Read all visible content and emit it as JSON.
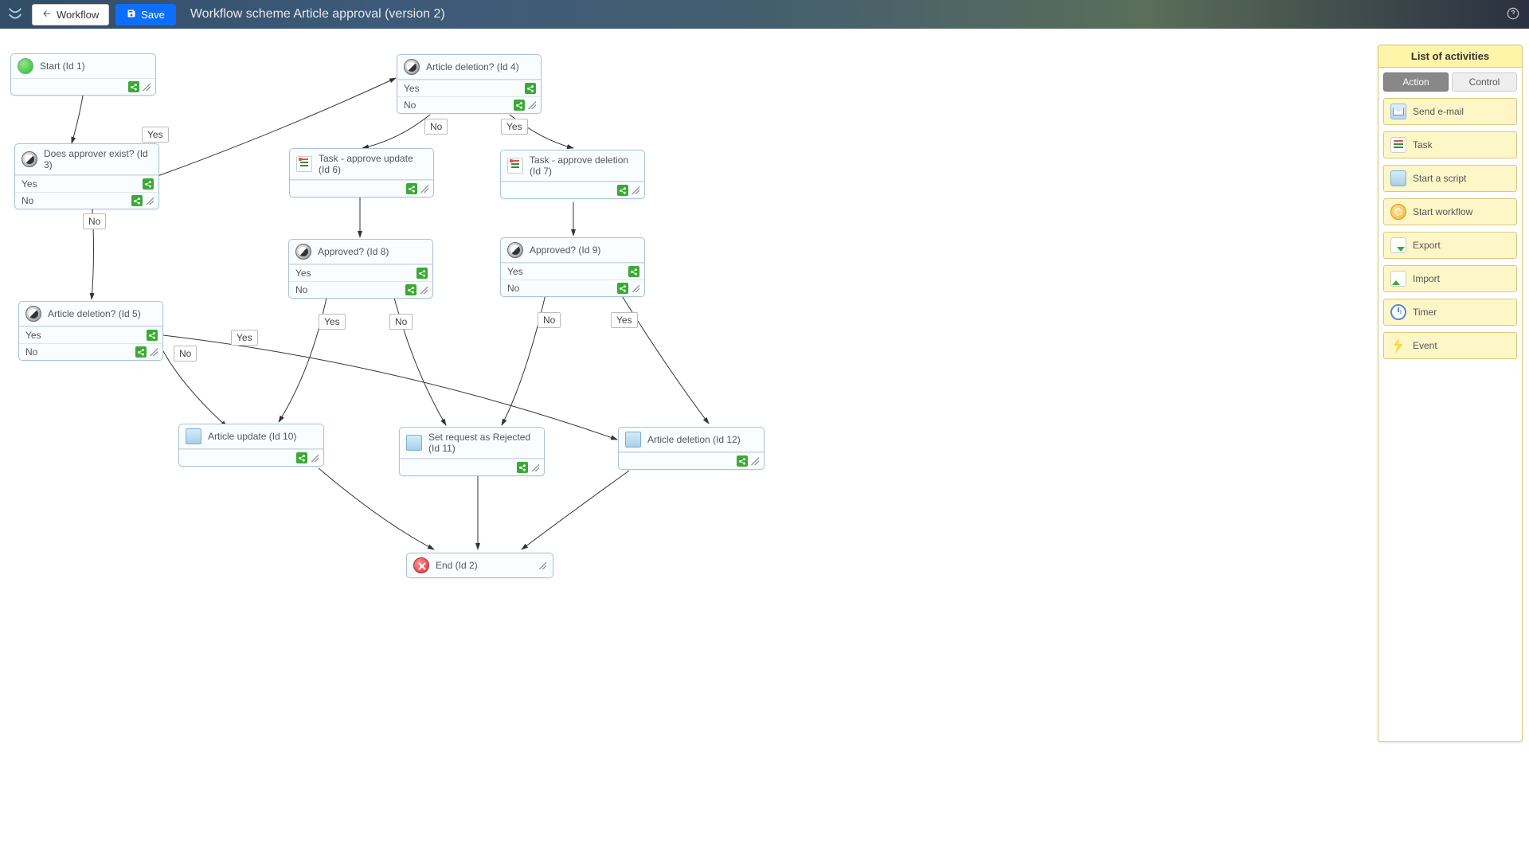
{
  "header": {
    "workflow_button": "Workflow",
    "save_button": "Save",
    "title": "Workflow scheme Article approval (version 2)"
  },
  "labels": {
    "yes": "Yes",
    "no": "No"
  },
  "nodes": {
    "n1": {
      "title": "Start (Id 1)"
    },
    "n3": {
      "title": "Does approver exist? (Id 3)"
    },
    "n4": {
      "title": "Article deletion? (Id 4)"
    },
    "n5": {
      "title": "Article deletion? (Id 5)"
    },
    "n6": {
      "title": "Task - approve update (Id 6)"
    },
    "n7": {
      "title": "Task - approve deletion (Id 7)"
    },
    "n8": {
      "title": "Approved? (Id 8)"
    },
    "n9": {
      "title": "Approved? (Id 9)"
    },
    "n10": {
      "title": "Article update (Id 10)"
    },
    "n11": {
      "title": "Set request as Rejected (Id 11)"
    },
    "n12": {
      "title": "Article deletion (Id 12)"
    },
    "n2": {
      "title": "End (Id 2)"
    }
  },
  "panel": {
    "title": "List of activities",
    "tabs": {
      "action": "Action",
      "control": "Control"
    },
    "items": {
      "email": "Send e-mail",
      "task": "Task",
      "script": "Start a script",
      "workflow": "Start workflow",
      "export": "Export",
      "import": "Import",
      "timer": "Timer",
      "event": "Event"
    }
  }
}
